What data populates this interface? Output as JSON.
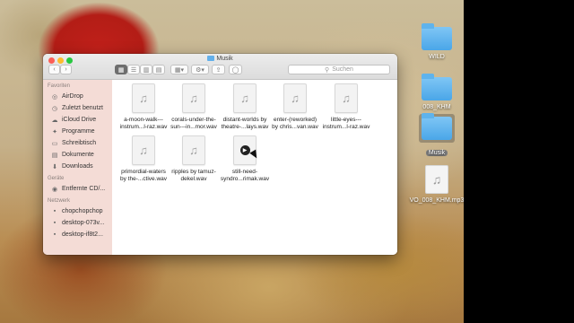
{
  "desktop": {
    "icons": [
      {
        "label": "WILD",
        "kind": "folder"
      },
      {
        "label": "008_KHM",
        "kind": "folder"
      },
      {
        "label": "Musik",
        "kind": "folder"
      },
      {
        "label": "VO_008_KHM.mp3",
        "kind": "file"
      }
    ],
    "colors": {
      "folder": "#5fb3ec",
      "right_panel": "#000000"
    }
  },
  "window": {
    "title": "Musik",
    "search_placeholder": "Suchen",
    "toolbar": {
      "back_glyph": "‹",
      "forward_glyph": "›",
      "view_icons": [
        "grid-view-icon",
        "list-view-icon",
        "column-view-icon",
        "coverflow-view-icon"
      ],
      "arrange_icon": "arrange-icon",
      "action_icon": "gear-icon",
      "share_icon": "share-icon",
      "tag_icon": "tag-icon"
    }
  },
  "sidebar": {
    "sections": [
      {
        "header": "Favoriten",
        "items": [
          {
            "label": "AirDrop",
            "icon": "airdrop-icon",
            "glyph": "◎"
          },
          {
            "label": "Zuletzt benutzt",
            "icon": "recent-icon",
            "glyph": "◷"
          },
          {
            "label": "iCloud Drive",
            "icon": "cloud-icon",
            "glyph": "☁"
          },
          {
            "label": "Programme",
            "icon": "applications-icon",
            "glyph": "✦"
          },
          {
            "label": "Schreibtisch",
            "icon": "desktop-icon",
            "glyph": "▭"
          },
          {
            "label": "Dokumente",
            "icon": "documents-icon",
            "glyph": "▤"
          },
          {
            "label": "Downloads",
            "icon": "downloads-icon",
            "glyph": "⬇"
          }
        ]
      },
      {
        "header": "Geräte",
        "items": [
          {
            "label": "Entfernte CD/...",
            "icon": "disc-icon",
            "glyph": "◉"
          }
        ]
      },
      {
        "header": "Netzwerk",
        "items": [
          {
            "label": "chopchopchop",
            "icon": "network-computer-icon",
            "glyph": "▪"
          },
          {
            "label": "desktop-073v...",
            "icon": "network-computer-icon",
            "glyph": "▪"
          },
          {
            "label": "desktop-if8t2...",
            "icon": "network-computer-icon",
            "glyph": "▪"
          }
        ]
      }
    ]
  },
  "files": [
    {
      "line1": "a-moon-walk---",
      "line2": "instrum...l-raz.wav",
      "playing": false
    },
    {
      "line1": "corals-under-the-",
      "line2": "sun---in...mor.wav",
      "playing": false
    },
    {
      "line1": "distant-worlds by",
      "line2": "theatre-...lays.wav",
      "playing": false
    },
    {
      "line1": "enter-(reworked)",
      "line2": "by chris...van.wav",
      "playing": false
    },
    {
      "line1": "little-eyes---",
      "line2": "instrum...l-raz.wav",
      "playing": false
    },
    {
      "line1": "primordial-waters",
      "line2": "by the-...ctive.wav",
      "playing": false
    },
    {
      "line1": "ripples by tamuz-",
      "line2": "dekel.wav",
      "playing": false
    },
    {
      "line1": "still-need-",
      "line2": "syndro...rimak.wav",
      "playing": true
    }
  ],
  "colors": {
    "sidebar_bg": "#f4dcd6",
    "close": "#fc5f57",
    "minimize": "#fdbc2e",
    "zoom": "#27c840"
  }
}
